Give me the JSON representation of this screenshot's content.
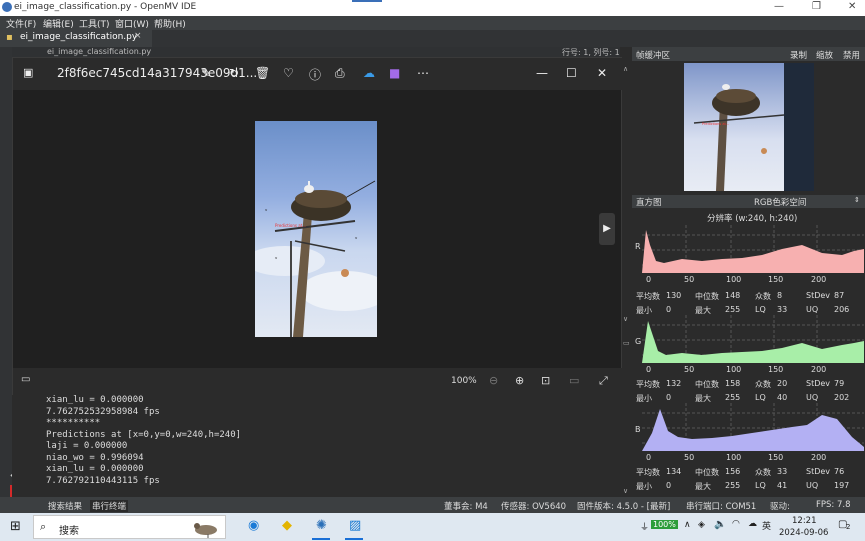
{
  "app": {
    "title": "ei_image_classification.py - OpenMV IDE"
  },
  "menu": [
    "文件(F)",
    "编辑(E)",
    "工具(T)",
    "窗口(W)",
    "帮助(H)"
  ],
  "tab": {
    "label": "ei_image_classification.py",
    "close": "×"
  },
  "subtab": {
    "label": "ei_image_classification.py",
    "position": "行号: 1, 列号: 1"
  },
  "viewer": {
    "filename": "2f8f6ec745cd14a317943e09d1...",
    "zoom": "100%",
    "photo_overlay_text": "Predictions at..."
  },
  "terminal": {
    "lines": [
      "xian_lu = 0.000000",
      "7.762752532958984 fps",
      "**********",
      "Predictions at [x=0,y=0,w=240,h=240]",
      "laji = 0.000000",
      "niao_wo = 0.996094",
      "xian_lu = 0.000000",
      "7.762792110443115 fps"
    ]
  },
  "framebuffer": {
    "title": "帧缓冲区",
    "record": "录制",
    "zoom": "缩放",
    "disable": "禁用"
  },
  "histogram": {
    "title": "直方图",
    "colorspace": "RGB色彩空间",
    "resolution": "分辨率 (w:240, h:240)",
    "ticks": [
      "0",
      "50",
      "100",
      "150",
      "200"
    ],
    "channels": [
      {
        "name": "R",
        "color": "#f7b0b0",
        "mean": "130",
        "median": "148",
        "mode": "8",
        "stdev": "87",
        "min": "0",
        "max": "255",
        "lq": "33",
        "uq": "206"
      },
      {
        "name": "G",
        "color": "#a8eea8",
        "mean": "132",
        "median": "158",
        "mode": "20",
        "stdev": "79",
        "min": "0",
        "max": "255",
        "lq": "40",
        "uq": "202"
      },
      {
        "name": "B",
        "color": "#b3b0f3",
        "mean": "134",
        "median": "156",
        "mode": "33",
        "stdev": "76",
        "min": "0",
        "max": "255",
        "lq": "41",
        "uq": "197"
      }
    ],
    "labels": {
      "mean": "平均数",
      "median": "中位数",
      "mode": "众数",
      "stdev": "StDev",
      "min": "最小",
      "max": "最大",
      "lq": "LQ",
      "uq": "UQ"
    }
  },
  "statusbar": {
    "search": "搜索结果",
    "serial": "串行终端",
    "board": "董事会: M4",
    "sensor": "传感器: OV5640",
    "firmware": "固件版本: 4.5.0 - [最新]",
    "port": "串行端口: COM51",
    "drive": "驱动:",
    "fps": "FPS:  7.8"
  },
  "taskbar": {
    "search": "搜索",
    "battery": "100%",
    "lang": "英",
    "time": "12:21",
    "date": "2024-09-06",
    "notif": "2"
  }
}
